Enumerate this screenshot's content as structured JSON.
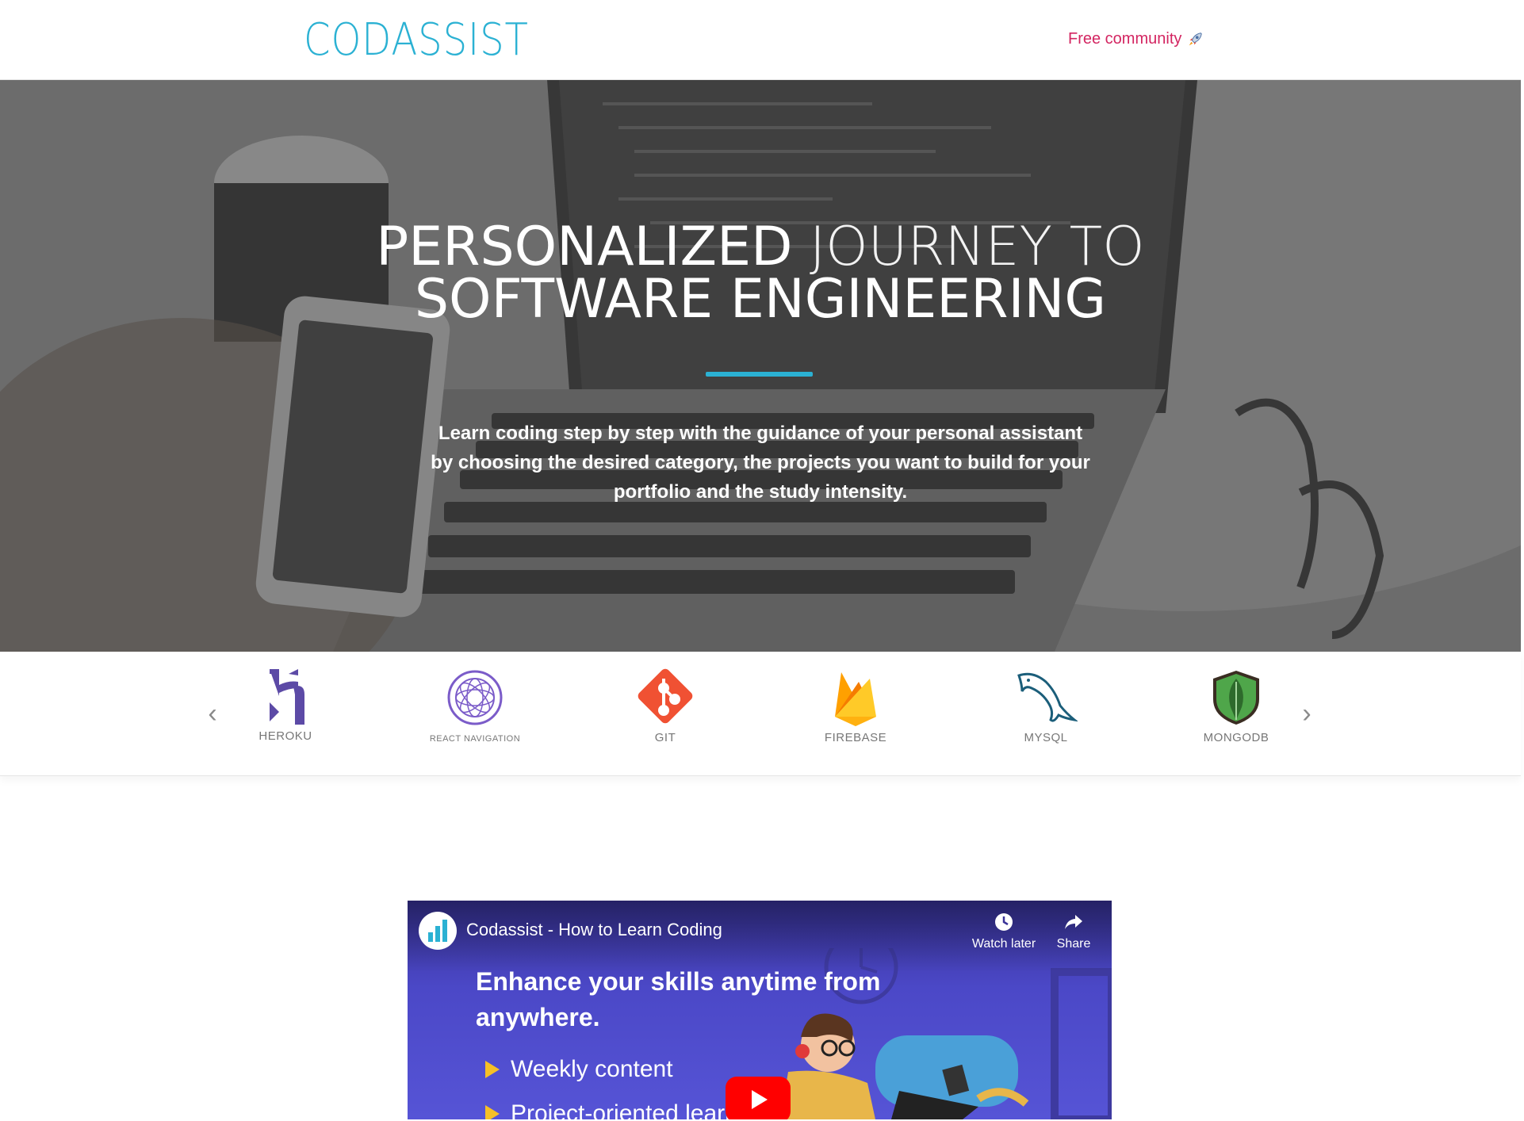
{
  "navbar": {
    "brand": "CODASSIST",
    "community_link": "Free community",
    "community_icon": "rocket-icon"
  },
  "hero": {
    "title_line1_bold": "PERSONALIZED",
    "title_line1_light": " JOURNEY TO",
    "title_line2": "SOFTWARE ENGINEERING",
    "description": "Learn coding step by step with the guidance of your personal assistant by choosing the desired category, the projects you want to build for your portfolio and the study intensity.",
    "accent_color": "#2bb1d3"
  },
  "technologies": {
    "prev_icon": "chevron-left-icon",
    "next_icon": "chevron-right-icon",
    "items": [
      {
        "label": "HEROKU",
        "icon": "heroku-logo"
      },
      {
        "label": "REACT NAVIGATION",
        "icon": "react-navigation-logo"
      },
      {
        "label": "GIT",
        "icon": "git-logo"
      },
      {
        "label": "FIREBASE",
        "icon": "firebase-logo"
      },
      {
        "label": "MYSQL",
        "icon": "mysql-logo"
      },
      {
        "label": "MONGODB",
        "icon": "mongodb-logo"
      }
    ]
  },
  "video": {
    "title": "Codassist - How to Learn Coding",
    "watch_later": "Watch later",
    "share": "Share",
    "heading": "Enhance your skills anytime from anywhere.",
    "bullets": [
      "Weekly content",
      "Project-oriented learn"
    ]
  }
}
